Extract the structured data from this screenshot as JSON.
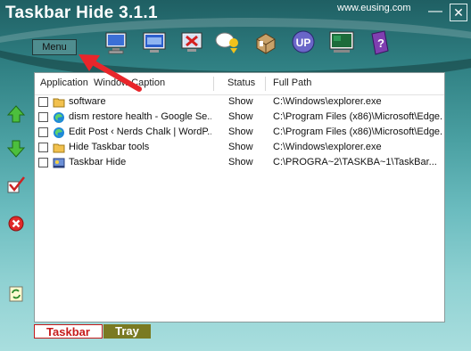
{
  "window": {
    "title": "Taskbar Hide 3.1.1",
    "site": "www.eusing.com",
    "minimize": "—",
    "close": "✕"
  },
  "menu": {
    "label": "Menu"
  },
  "toolbar": [
    {
      "name": "monitor-icon"
    },
    {
      "name": "window-icon"
    },
    {
      "name": "close-window-icon"
    },
    {
      "name": "chat-icon"
    },
    {
      "name": "database-icon"
    },
    {
      "name": "update-icon",
      "label": "UP"
    },
    {
      "name": "display-icon"
    },
    {
      "name": "help-book-icon",
      "label": "?"
    }
  ],
  "list": {
    "columns": [
      "Application",
      "Window Caption",
      "Status",
      "Full Path"
    ],
    "rows": [
      {
        "icon": "folder-icon",
        "name": "software",
        "status": "Show",
        "path": "C:\\Windows\\explorer.exe"
      },
      {
        "icon": "edge-icon",
        "name": "dism restore health - Google Se...",
        "status": "Show",
        "path": "C:\\Program Files (x86)\\Microsoft\\Edge..."
      },
      {
        "icon": "edge-icon",
        "name": "Edit Post ‹ Nerds Chalk | WordP...",
        "status": "Show",
        "path": "C:\\Program Files (x86)\\Microsoft\\Edge..."
      },
      {
        "icon": "folder-icon",
        "name": "Hide Taskbar tools",
        "status": "Show",
        "path": "C:\\Windows\\explorer.exe"
      },
      {
        "icon": "app-icon",
        "name": "Taskbar Hide",
        "status": "Show",
        "path": "C:\\PROGRA~2\\TASKBA~1\\TaskBar..."
      }
    ]
  },
  "tabs": {
    "taskbar": "Taskbar",
    "tray": "Tray"
  },
  "colors": {
    "accent": "#c61a1a",
    "annotation": "#e8262b"
  }
}
